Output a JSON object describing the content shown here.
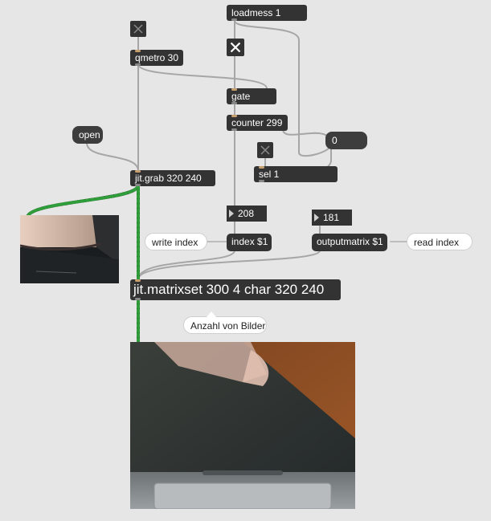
{
  "patcher": {
    "objects": {
      "loadmess": "loadmess 1",
      "qmetro": "qmetro 30",
      "gate": "gate",
      "counter": "counter 299",
      "sel": "sel 1",
      "jit_grab": "jit.grab 320 240",
      "index_msg": "index $1",
      "outputmatrix_msg": "outputmatrix $1",
      "matrixset": "jit.matrixset 300 4 char 320 240"
    },
    "messages": {
      "open": "open",
      "zero": "0"
    },
    "numbers": {
      "index_value": "208",
      "read_value": "181"
    },
    "comments": {
      "write_index": "write index",
      "read_index": "read index",
      "anzahl": "Anzahl von Bilder"
    },
    "toggles": {
      "metro_toggle": false,
      "gate_toggle": true,
      "sel_toggle": false
    }
  },
  "colors": {
    "background": "#e6e6e6",
    "object": "#333333",
    "patchcord": "#a6a6a6",
    "matrix_cord_green": "#2f9e3a",
    "matrix_cord_dark": "#1a1a1a"
  },
  "icons": {
    "toggle": "x-cross-icon",
    "number_arrow": "triangle-right-icon"
  }
}
